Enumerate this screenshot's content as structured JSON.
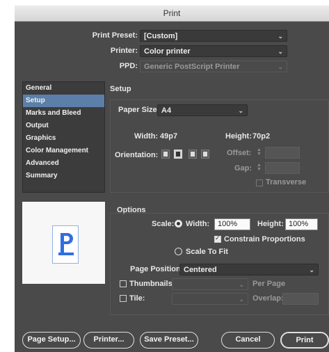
{
  "window": {
    "title": "Print"
  },
  "preset": {
    "label": "Print Preset:",
    "value": "[Custom]"
  },
  "printer": {
    "label": "Printer:",
    "value": "Color printer"
  },
  "ppd": {
    "label": "PPD:",
    "value": "Generic PostScript Printer"
  },
  "sidebar": {
    "items": [
      {
        "label": "General"
      },
      {
        "label": "Setup"
      },
      {
        "label": "Marks and Bleed"
      },
      {
        "label": "Output"
      },
      {
        "label": "Graphics"
      },
      {
        "label": "Color Management"
      },
      {
        "label": "Advanced"
      },
      {
        "label": "Summary"
      }
    ],
    "selected": "Setup"
  },
  "setup": {
    "heading": "Setup",
    "paper_size_label": "Paper Size:",
    "paper_size_value": "A4",
    "width_label": "Width:",
    "width_value": "49p7",
    "height_label": "Height:",
    "height_value": "70p2",
    "orientation_label": "Orientation:",
    "offset_label": "Offset:",
    "gap_label": "Gap:",
    "transverse_label": "Transverse"
  },
  "options": {
    "heading": "Options",
    "scale_label": "Scale:",
    "width_label": "Width:",
    "width_value": "100%",
    "height_label": "Height:",
    "height_value": "100%",
    "constrain_label": "Constrain Proportions",
    "scale_to_fit_label": "Scale To Fit",
    "page_position_label": "Page Position:",
    "page_position_value": "Centered",
    "thumbnails_label": "Thumbnails:",
    "per_page_label": "Per Page",
    "tile_label": "Tile:",
    "overlap_label": "Overlap:"
  },
  "buttons": {
    "page_setup": "Page Setup...",
    "printer": "Printer...",
    "save_preset": "Save Preset...",
    "cancel": "Cancel",
    "print": "Print"
  },
  "colors": {
    "dialog_bg": "#4a4a4a",
    "selection": "#5b7fa8",
    "preview_glyph": "#2f6fe0"
  }
}
